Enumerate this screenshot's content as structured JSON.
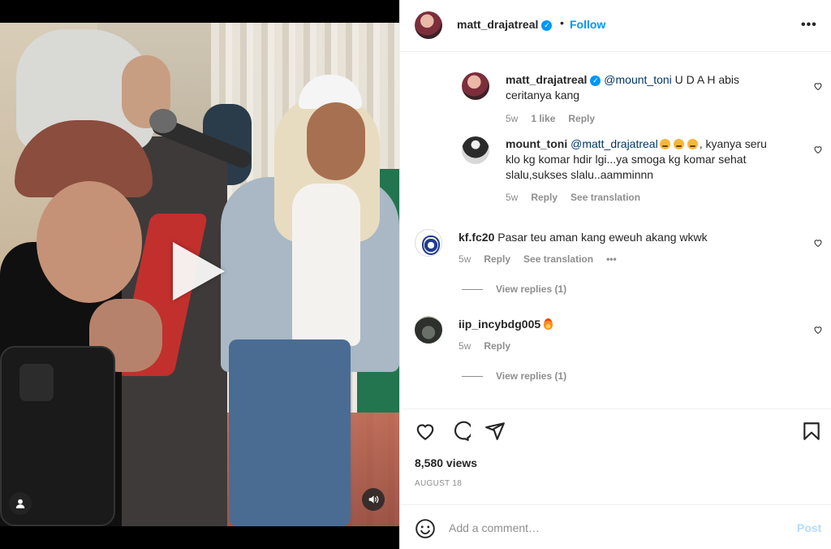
{
  "header": {
    "username": "matt_drajatreal",
    "dot": "•",
    "follow_label": "Follow",
    "more_label": "•••"
  },
  "comments": [
    {
      "username": "matt_drajatreal",
      "mention": "@mount_toni",
      "text_line1": " U D A H abis",
      "text_line2": "ceritanya kang",
      "time": "5w",
      "likes": "1 like",
      "reply": "Reply",
      "verified": true
    },
    {
      "username": "mount_toni",
      "mention": "@matt_drajatreal",
      "text_line1": ", kyanya seru",
      "text_line2": "klo kg komar hdir lgi...ya smoga kg komar sehat",
      "text_line3": "slalu,sukses slalu..aamminnn",
      "time": "5w",
      "reply": "Reply",
      "see_translation": "See translation"
    },
    {
      "username": "kf.fc20",
      "text": "Pasar teu aman kang eweuh akang wkwk",
      "time": "5w",
      "reply": "Reply",
      "see_translation": "See translation",
      "more": "•••",
      "view_replies": "View replies (1)"
    },
    {
      "username": "iip_incybdg005",
      "time": "5w",
      "reply": "Reply",
      "view_replies": "View replies (1)"
    }
  ],
  "actions": {
    "views": "8,580 views",
    "date": "AUGUST 18"
  },
  "add_comment": {
    "placeholder": "Add a comment…",
    "post_label": "Post"
  },
  "colors": {
    "accent": "#0095f6",
    "post_disabled": "#b3dbff",
    "muted": "#8e8e8e",
    "text": "#262626"
  },
  "icons": [
    "play-icon",
    "user-icon",
    "sound-icon",
    "verified-icon",
    "more-icon",
    "heart-icon",
    "comment-icon",
    "share-icon",
    "bookmark-icon",
    "emoji-icon",
    "fire-emoji"
  ]
}
